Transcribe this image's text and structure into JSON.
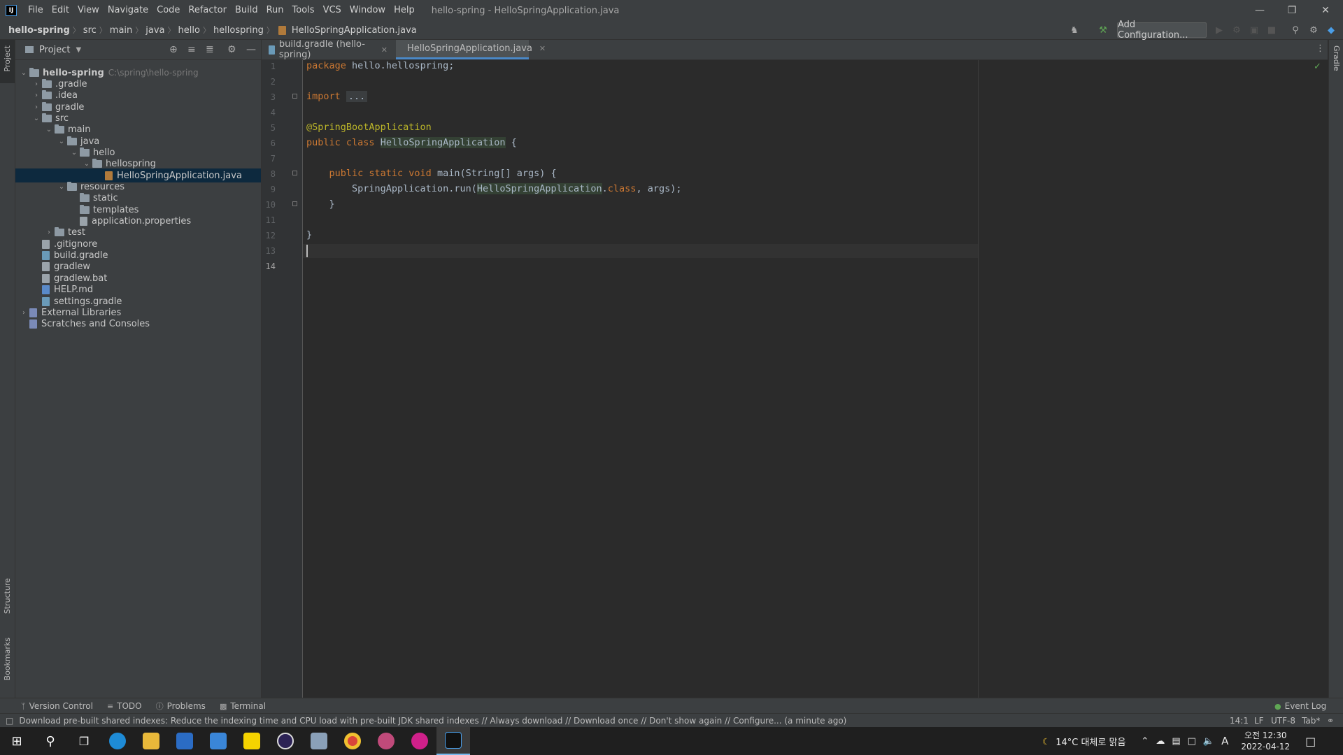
{
  "titlebar": {
    "menus": [
      "File",
      "Edit",
      "View",
      "Navigate",
      "Code",
      "Refactor",
      "Build",
      "Run",
      "Tools",
      "VCS",
      "Window",
      "Help"
    ],
    "window_title": "hello-spring - HelloSpringApplication.java"
  },
  "breadcrumb": [
    "hello-spring",
    "src",
    "main",
    "java",
    "hello",
    "hellospring",
    "HelloSpringApplication.java"
  ],
  "toolbar": {
    "add_config_label": "Add Configuration..."
  },
  "left_stripe": {
    "project": "Project",
    "structure": "Structure",
    "bookmarks": "Bookmarks"
  },
  "right_stripe": {
    "gradle": "Gradle"
  },
  "project_panel": {
    "title": "Project",
    "tree": [
      {
        "label": "hello-spring",
        "hint": "C:\\spring\\hello-spring",
        "depth": 0,
        "type": "folder",
        "expanded": true,
        "bold": true
      },
      {
        "label": ".gradle",
        "depth": 1,
        "type": "folder",
        "expanded": false
      },
      {
        "label": ".idea",
        "depth": 1,
        "type": "folder",
        "expanded": false
      },
      {
        "label": "gradle",
        "depth": 1,
        "type": "folder",
        "expanded": false
      },
      {
        "label": "src",
        "depth": 1,
        "type": "folder",
        "expanded": true
      },
      {
        "label": "main",
        "depth": 2,
        "type": "folder",
        "expanded": true
      },
      {
        "label": "java",
        "depth": 3,
        "type": "folder",
        "expanded": true
      },
      {
        "label": "hello",
        "depth": 4,
        "type": "folder",
        "expanded": true
      },
      {
        "label": "hellospring",
        "depth": 5,
        "type": "folder",
        "expanded": true
      },
      {
        "label": "HelloSpringApplication.java",
        "depth": 6,
        "type": "java",
        "selected": true
      },
      {
        "label": "resources",
        "depth": 3,
        "type": "folder",
        "expanded": true
      },
      {
        "label": "static",
        "depth": 4,
        "type": "folder"
      },
      {
        "label": "templates",
        "depth": 4,
        "type": "folder"
      },
      {
        "label": "application.properties",
        "depth": 4,
        "type": "file"
      },
      {
        "label": "test",
        "depth": 2,
        "type": "folder",
        "expanded": false
      },
      {
        "label": ".gitignore",
        "depth": 1,
        "type": "file"
      },
      {
        "label": "build.gradle",
        "depth": 1,
        "type": "gradle"
      },
      {
        "label": "gradlew",
        "depth": 1,
        "type": "file"
      },
      {
        "label": "gradlew.bat",
        "depth": 1,
        "type": "file"
      },
      {
        "label": "HELP.md",
        "depth": 1,
        "type": "md"
      },
      {
        "label": "settings.gradle",
        "depth": 1,
        "type": "gradle"
      },
      {
        "label": "External Libraries",
        "depth": 0,
        "type": "lib",
        "expanded": false
      },
      {
        "label": "Scratches and Consoles",
        "depth": 0,
        "type": "lib"
      }
    ]
  },
  "editor": {
    "tabs": [
      {
        "label": "build.gradle (hello-spring)",
        "active": false
      },
      {
        "label": "HelloSpringApplication.java",
        "active": true
      }
    ],
    "line_numbers": [
      "1",
      "2",
      "3",
      "4",
      "5",
      "6",
      "7",
      "8",
      "9",
      "10",
      "11",
      "12",
      "13",
      "14"
    ]
  },
  "bottom_tools": [
    "Version Control",
    "TODO",
    "Problems",
    "Terminal"
  ],
  "event_log": "Event Log",
  "status": {
    "message": "Download pre-built shared indexes: Reduce the indexing time and CPU load with pre-built JDK shared indexes // Always download // Download once // Don't show again // Configure... (a minute ago)",
    "position": "14:1",
    "line_sep": "LF",
    "encoding": "UTF-8",
    "indent": "Tab*"
  },
  "taskbar": {
    "weather": "14°C 대체로 맑음",
    "time": "오전 12:30",
    "date": "2022-04-12",
    "ime": "A"
  },
  "colors": {
    "keyword": "#cc7832",
    "annotation": "#bbb529",
    "text": "#a9b7c6",
    "accent": "#4a88c7"
  }
}
